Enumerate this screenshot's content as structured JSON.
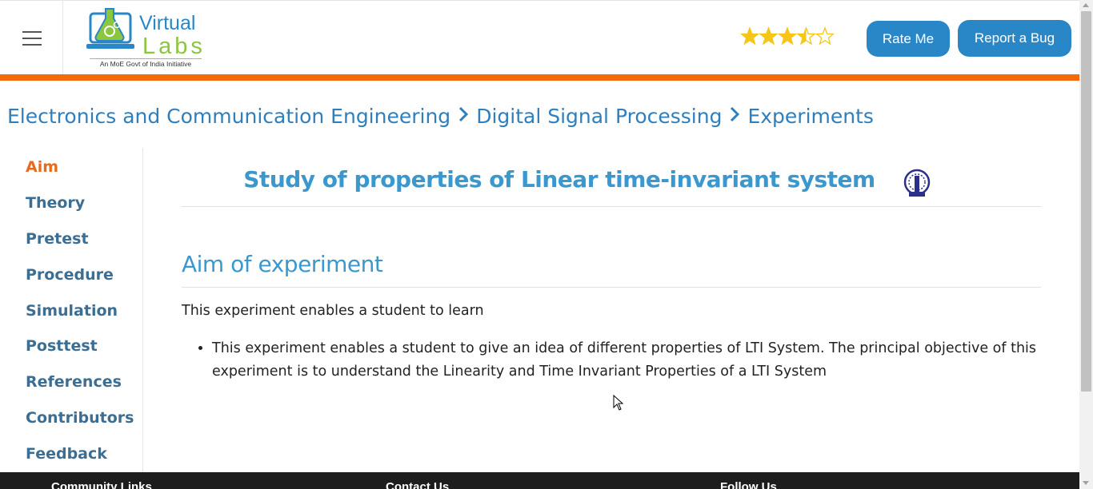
{
  "header": {
    "logo_text_top": "Virtual",
    "logo_text_bottom": "Labs",
    "logo_tagline": "An MoE Govt of India Initiative",
    "rating": 3.5,
    "rating_max": 5,
    "rate_button": "Rate Me",
    "bug_button": "Report a Bug"
  },
  "breadcrumb": [
    "Electronics and Communication Engineering",
    "Digital Signal Processing",
    "Experiments"
  ],
  "sidebar": {
    "items": [
      {
        "label": "Aim",
        "active": true
      },
      {
        "label": "Theory"
      },
      {
        "label": "Pretest"
      },
      {
        "label": "Procedure"
      },
      {
        "label": "Simulation"
      },
      {
        "label": "Posttest"
      },
      {
        "label": "References"
      },
      {
        "label": "Contributors"
      },
      {
        "label": "Feedback"
      }
    ]
  },
  "main": {
    "title": "Study of properties of Linear time-invariant system",
    "aim_heading": "Aim of experiment",
    "intro": "This experiment enables a student to learn",
    "bullets": [
      "This experiment enables a student to give an idea of different properties of LTI System. The principal objective of this experiment is to understand the Linearity and Time Invariant Properties of a LTI System"
    ]
  },
  "footer": {
    "community": "Community Links",
    "contact": "Contact Us",
    "follow": "Follow Us"
  },
  "colors": {
    "accent_blue": "#2a87c7",
    "accent_orange": "#f26c0b",
    "title_blue": "#3a98cf",
    "star_gold": "#f5c518"
  },
  "icons": [
    "hamburger-menu-icon",
    "virtual-labs-logo",
    "star-icon",
    "chevron-right-icon",
    "institute-emblem-icon",
    "mouse-cursor-icon"
  ]
}
